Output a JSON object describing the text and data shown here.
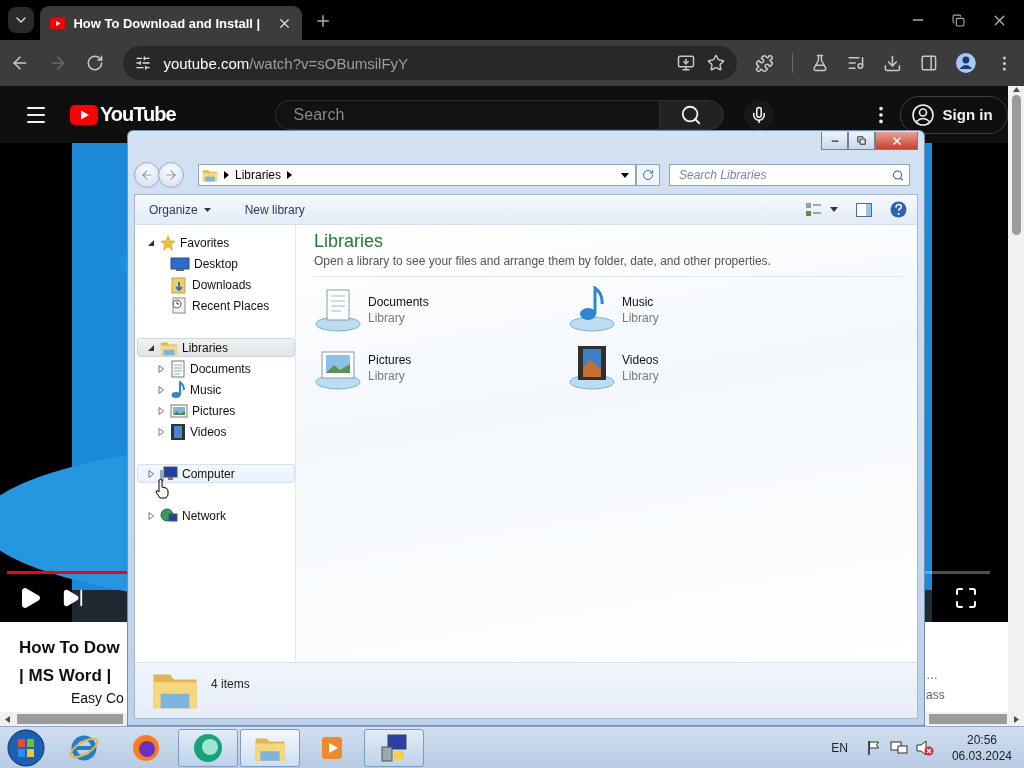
{
  "browser": {
    "tabs": [
      {
        "title": "How To Download and Install |",
        "selected": true
      }
    ],
    "back": {
      "disabled": false
    },
    "forward": {
      "disabled": true
    },
    "address": {
      "domain": "youtube.com",
      "path": "/watch?v=sOBumsilFyY"
    }
  },
  "youtube": {
    "logo": "YouTube",
    "search": {
      "placeholder": "Search"
    },
    "sign_in": "Sign in"
  },
  "video": {
    "kind": "picture",
    "progress": {
      "level": 0.13
    }
  },
  "below_video": {
    "title_lines": [
      "How To Dow",
      "| MS Word |"
    ],
    "line_3": "Easy Co",
    "right_texts": [
      "…",
      "ass"
    ]
  },
  "explorer": {
    "address": {
      "crumbs": [
        "Libraries"
      ]
    },
    "search": {
      "placeholder": "Search Libraries"
    },
    "commands": [
      {
        "label": "Organize",
        "menu": true
      },
      {
        "label": "New library",
        "menu": false
      }
    ],
    "nav_tree": [
      {
        "label": "Favorites",
        "expanded": true,
        "selected": false,
        "hovered": false,
        "children": [
          {
            "label": "Desktop"
          },
          {
            "label": "Downloads"
          },
          {
            "label": "Recent Places"
          }
        ]
      },
      {
        "label": "Libraries",
        "expanded": true,
        "selected": true,
        "hovered": false,
        "children": [
          {
            "label": "Documents",
            "expanded": false
          },
          {
            "label": "Music",
            "expanded": false
          },
          {
            "label": "Pictures",
            "expanded": false
          },
          {
            "label": "Videos",
            "expanded": false
          }
        ]
      },
      {
        "label": "Computer",
        "expanded": false,
        "selected": false,
        "hovered": true
      },
      {
        "label": "Network",
        "expanded": false,
        "selected": false,
        "hovered": false
      }
    ],
    "heading": "Libraries",
    "description": "Open a library to see your files and arrange them by folder, date, and other properties.",
    "items": [
      {
        "name": "Documents",
        "type": "Library"
      },
      {
        "name": "Music",
        "type": "Library"
      },
      {
        "name": "Pictures",
        "type": "Library"
      },
      {
        "name": "Videos",
        "type": "Library"
      }
    ],
    "status": "4 items"
  },
  "taskbar": {
    "apps": [
      {
        "running": false,
        "selected": false
      },
      {
        "running": false,
        "selected": false
      },
      {
        "running": true,
        "selected": false
      },
      {
        "running": true,
        "selected": true
      },
      {
        "running": false,
        "selected": false
      },
      {
        "running": true,
        "selected": false
      }
    ],
    "tray": {
      "language": "EN",
      "volume_muted": true,
      "time": "20:56",
      "date": "06.03.2024"
    }
  }
}
